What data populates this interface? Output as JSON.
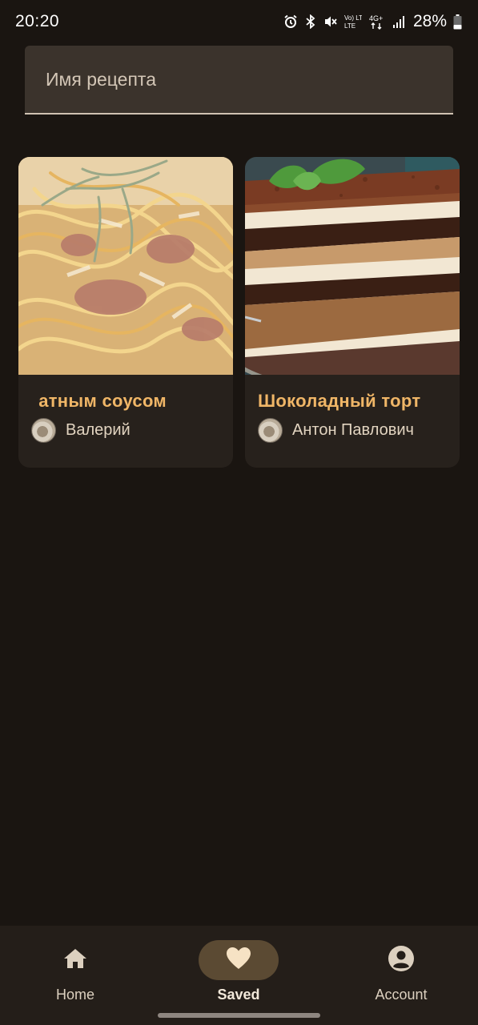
{
  "status_bar": {
    "time": "20:20",
    "network": "4G+",
    "volte": "Vo) LTE",
    "battery": "28%",
    "icons": [
      "alarm-icon",
      "bluetooth-icon",
      "mute-icon",
      "volte-icon",
      "network-4g-icon",
      "signal-icon",
      "battery-icon"
    ]
  },
  "search": {
    "placeholder": "Имя рецепта"
  },
  "recipes": [
    {
      "title": "атным соусом",
      "author": "Валерий",
      "image": "pasta-photo"
    },
    {
      "title": "Шоколадный торт",
      "author": "Антон Павлович",
      "image": "tiramisu-cake-photo"
    }
  ],
  "nav": {
    "home_label": "Home",
    "saved_label": "Saved",
    "account_label": "Account",
    "selected": "saved"
  },
  "colors": {
    "background": "#1a1511",
    "card": "#27211c",
    "title_accent": "#f0b667",
    "nav_selected_pill": "#5b4a33"
  }
}
